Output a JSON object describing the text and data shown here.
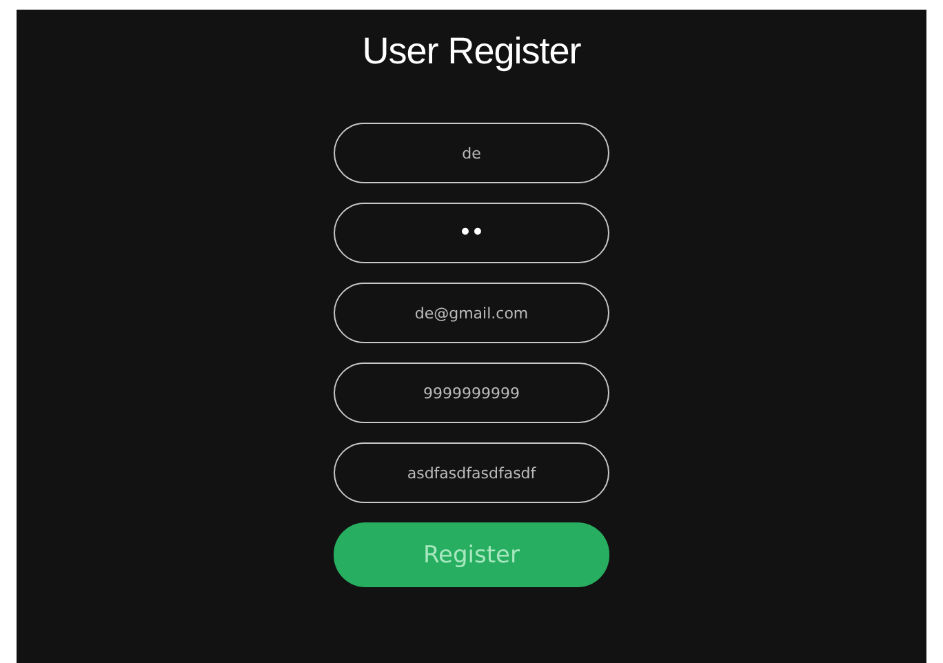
{
  "title": "User Register",
  "fields": [
    {
      "kind": "text",
      "value": "de"
    },
    {
      "kind": "password",
      "value": "••"
    },
    {
      "kind": "text",
      "value": "de@gmail.com"
    },
    {
      "kind": "text",
      "value": "9999999999"
    },
    {
      "kind": "text",
      "value": "asdfasdfasdfasdf"
    }
  ],
  "button": "Register"
}
